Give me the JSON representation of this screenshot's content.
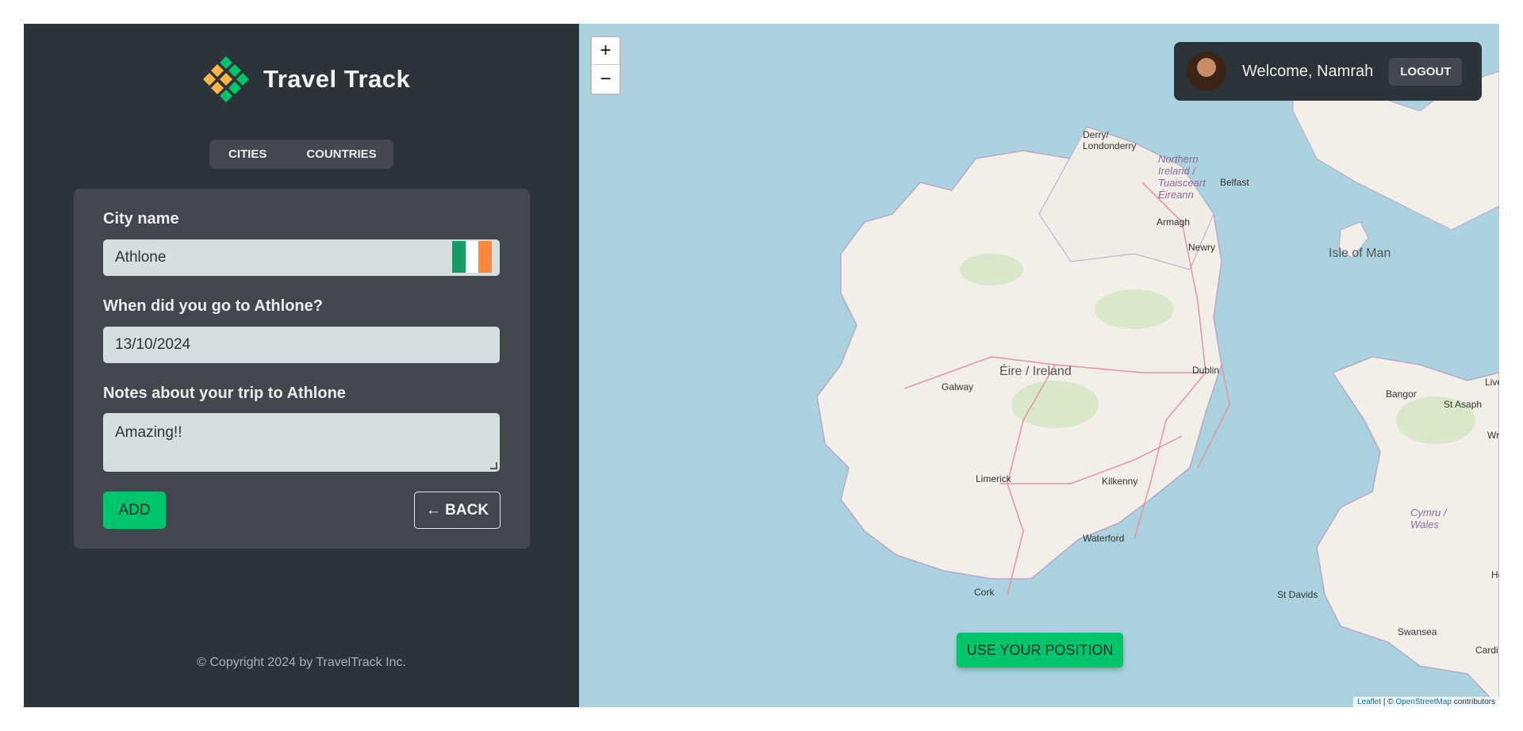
{
  "brand": {
    "name": "Travel Track"
  },
  "nav": {
    "tabs": [
      "CITIES",
      "COUNTRIES"
    ]
  },
  "form": {
    "city_label": "City name",
    "city_value": "Athlone",
    "date_label": "When did you go to Athlone?",
    "date_value": "13/10/2024",
    "notes_label": "Notes about your trip to Athlone",
    "notes_value": "Amazing!!",
    "add_label": "ADD",
    "back_label": "← BACK"
  },
  "footer": {
    "copyright": "© Copyright 2024 by TravelTrack Inc."
  },
  "user": {
    "welcome": "Welcome, Namrah",
    "logout_label": "LOGOUT"
  },
  "map": {
    "zoom_in": "+",
    "zoom_out": "−",
    "position_button": "USE YOUR POSITION",
    "attribution_leaflet": "Leaflet",
    "attribution_sep": " | © ",
    "attribution_osm": "OpenStreetMap",
    "attribution_tail": " contributors",
    "labels": {
      "derry": "Derry/ Londonderry",
      "ni": "Northern Ireland / Tuaisceart Éireann",
      "belfast": "Belfast",
      "armagh": "Armagh",
      "newry": "Newry",
      "isle_of_man": "Isle of Man",
      "eire": "Éire / Ireland",
      "galway": "Galway",
      "dublin": "Dublin",
      "bangor": "Bangor",
      "st_asaph": "St Asaph",
      "limerick": "Limerick",
      "kilkenny": "Kilkenny",
      "waterford": "Waterford",
      "cork": "Cork",
      "st_davids": "St Davids",
      "swansea": "Swansea",
      "wales": "Cymru / Wales",
      "live": "Live",
      "wre": "Wre",
      "he": "He",
      "cardi": "Cardi"
    }
  },
  "colors": {
    "accent": "#00c46a",
    "sidebar": "#2d3439",
    "card": "#42474e",
    "sea": "#aad3df",
    "land": "#f2efe9"
  }
}
